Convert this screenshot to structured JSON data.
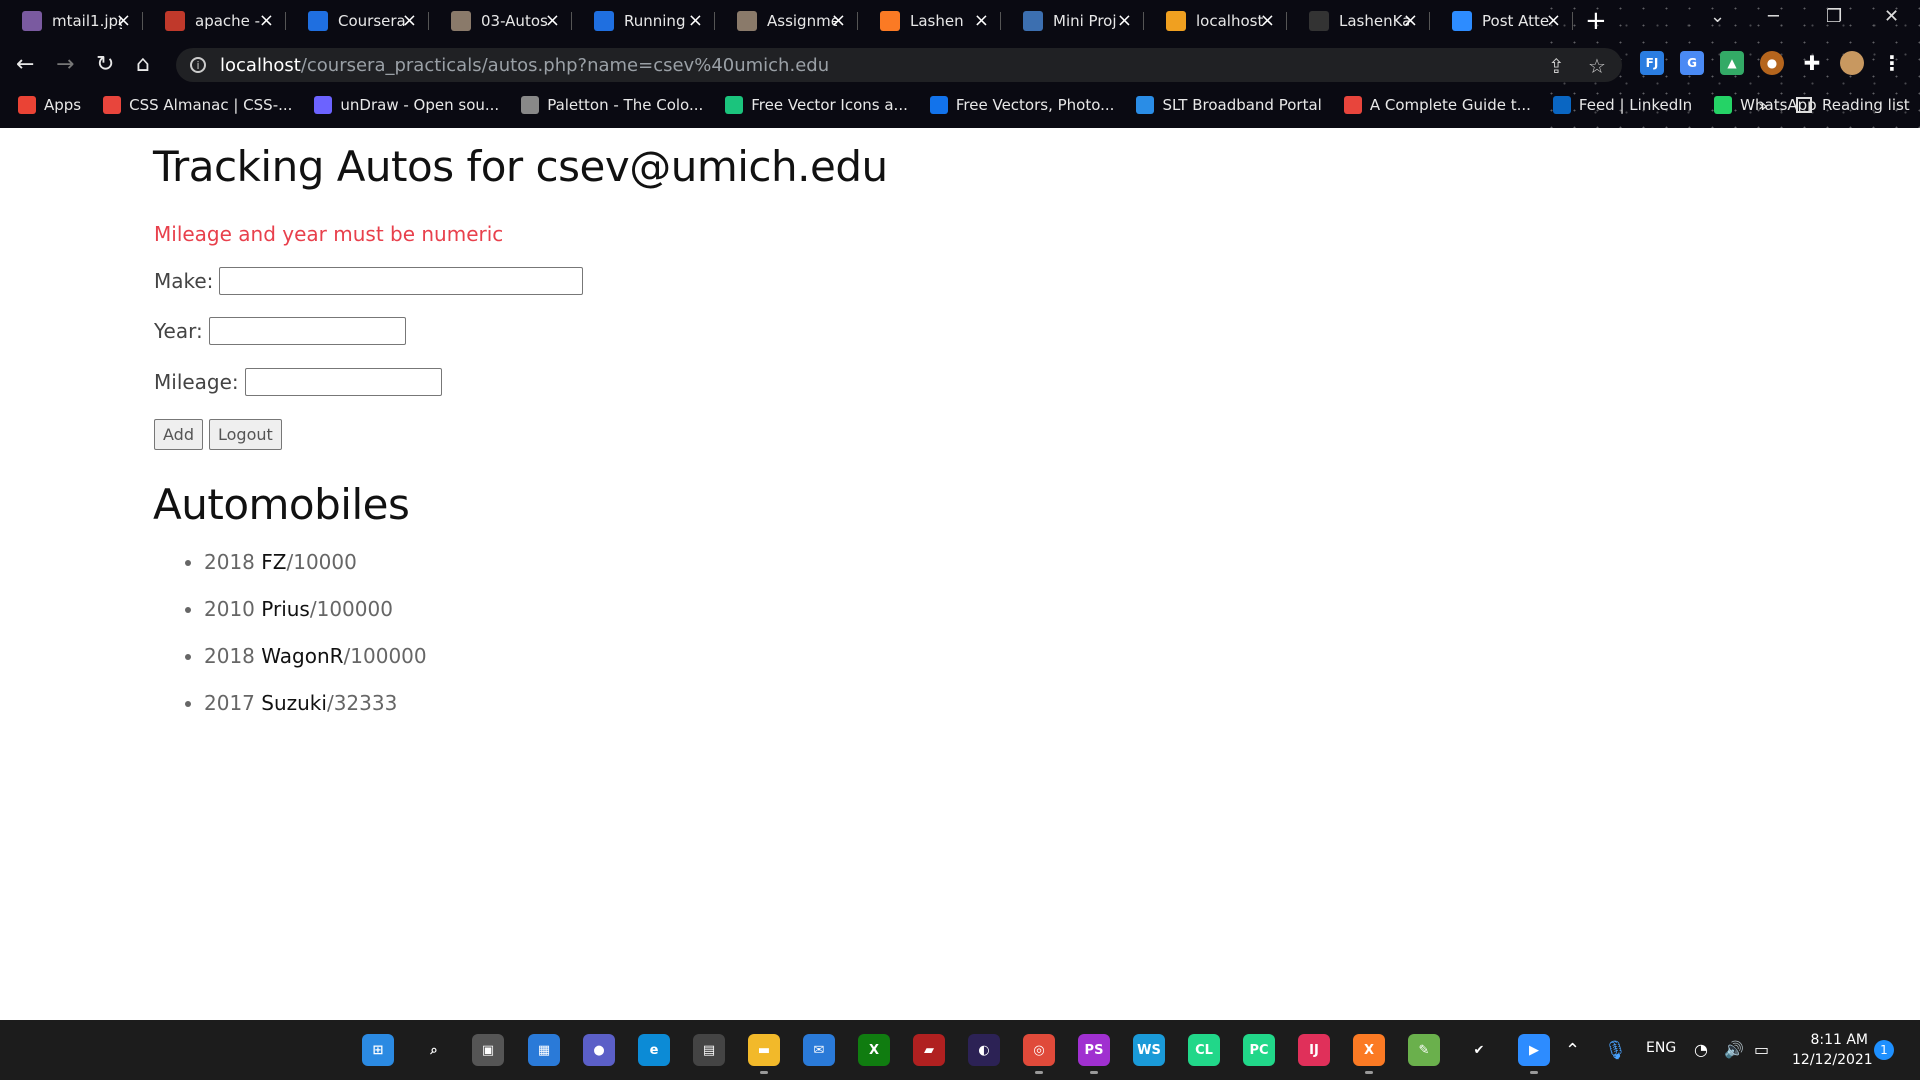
{
  "browser": {
    "tabs": [
      {
        "title": "mtail1.jpg",
        "icon": "image-icon",
        "color": "#7a5aa0"
      },
      {
        "title": "apache -",
        "icon": "apache-feather-icon",
        "color": "#c0392b"
      },
      {
        "title": "Coursera",
        "icon": "coursera-icon",
        "color": "#1f6fe0"
      },
      {
        "title": "03-Autos",
        "icon": "image-icon",
        "color": "#8a7a6a"
      },
      {
        "title": "Running",
        "icon": "coursera-icon",
        "color": "#1f6fe0"
      },
      {
        "title": "Assignme",
        "icon": "image-icon",
        "color": "#8a7a6a"
      },
      {
        "title": "Lashen",
        "icon": "xampp-icon",
        "color": "#fb7a24"
      },
      {
        "title": "Mini Proj",
        "icon": "image-icon",
        "color": "#3c6fb0"
      },
      {
        "title": "localhost",
        "icon": "phpmyadmin-icon",
        "color": "#f0a020"
      },
      {
        "title": "LashenKa",
        "icon": "github-icon",
        "color": "#333333"
      },
      {
        "title": "Post Atte",
        "icon": "zoom-icon",
        "color": "#2d8cff"
      }
    ],
    "new_tab": "+",
    "url_host": "localhost",
    "url_path": "/coursera_practicals/autos.php?name=csev%40umich.edu",
    "bookmarks": [
      {
        "label": "Apps",
        "icon": "apps-grid-icon",
        "color": "#ea4335"
      },
      {
        "label": "CSS Almanac | CSS-...",
        "icon": "css-tricks-icon",
        "color": "#e8453c"
      },
      {
        "label": "unDraw - Open sou...",
        "icon": "undraw-icon",
        "color": "#6c63ff"
      },
      {
        "label": "Paletton - The Colo...",
        "icon": "paletton-icon",
        "color": "#888888"
      },
      {
        "label": "Free Vector Icons a...",
        "icon": "flaticon-icon",
        "color": "#1bc47d"
      },
      {
        "label": "Free Vectors, Photo...",
        "icon": "freepik-icon",
        "color": "#1273eb"
      },
      {
        "label": "SLT Broadband Portal",
        "icon": "slt-icon",
        "color": "#2a8de6"
      },
      {
        "label": "A Complete Guide t...",
        "icon": "css-tricks-icon",
        "color": "#e8453c"
      },
      {
        "label": "Feed | LinkedIn",
        "icon": "linkedin-icon",
        "color": "#0a66c2"
      },
      {
        "label": "WhatsApp",
        "icon": "whatsapp-icon",
        "color": "#25d366"
      }
    ],
    "more_bookmarks": "»",
    "reading_list": "Reading list"
  },
  "page": {
    "title": "Tracking Autos for csev@umich.edu",
    "error": "Mileage and year must be numeric",
    "form": {
      "make_label": "Make:",
      "year_label": "Year:",
      "mileage_label": "Mileage:",
      "make_value": "",
      "year_value": "",
      "mileage_value": "",
      "add_label": "Add",
      "logout_label": "Logout"
    },
    "autos_heading": "Automobiles",
    "autos": [
      {
        "year": "2018",
        "make": "FZ",
        "mileage": "/10000"
      },
      {
        "year": "2010",
        "make": "Prius",
        "mileage": "/100000"
      },
      {
        "year": "2018",
        "make": "WagonR",
        "mileage": "/100000"
      },
      {
        "year": "2017",
        "make": "Suzuki",
        "mileage": "/32333"
      }
    ]
  },
  "taskbar": {
    "language": "ENG",
    "time": "8:11 AM",
    "date": "12/12/2021",
    "notification_count": "1",
    "chat_badge": "1"
  }
}
